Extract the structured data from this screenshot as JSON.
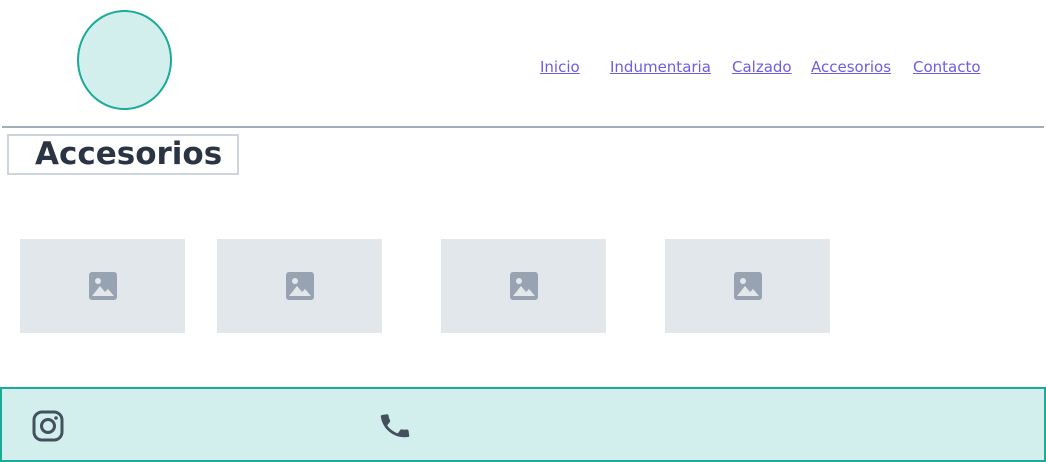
{
  "header": {
    "logo_icon": "logo-circle"
  },
  "nav": {
    "items": [
      {
        "label": "Inicio"
      },
      {
        "label": "Indumentaria"
      },
      {
        "label": "Calzado"
      },
      {
        "label": "Accesorios"
      },
      {
        "label": "Contacto"
      }
    ]
  },
  "main": {
    "title": "Accesorios",
    "products": [
      {
        "icon": "image-placeholder-icon"
      },
      {
        "icon": "image-placeholder-icon"
      },
      {
        "icon": "image-placeholder-icon"
      },
      {
        "icon": "image-placeholder-icon"
      }
    ]
  },
  "footer": {
    "icons": [
      "instagram-icon",
      "phone-icon"
    ]
  },
  "colors": {
    "accent": "#1aaa98",
    "accent_light": "#d2efed",
    "link": "#6c5ce7",
    "placeholder_bg": "#e2e7eb",
    "placeholder_icon": "#97a3b1",
    "icon_dark": "#44505e"
  }
}
